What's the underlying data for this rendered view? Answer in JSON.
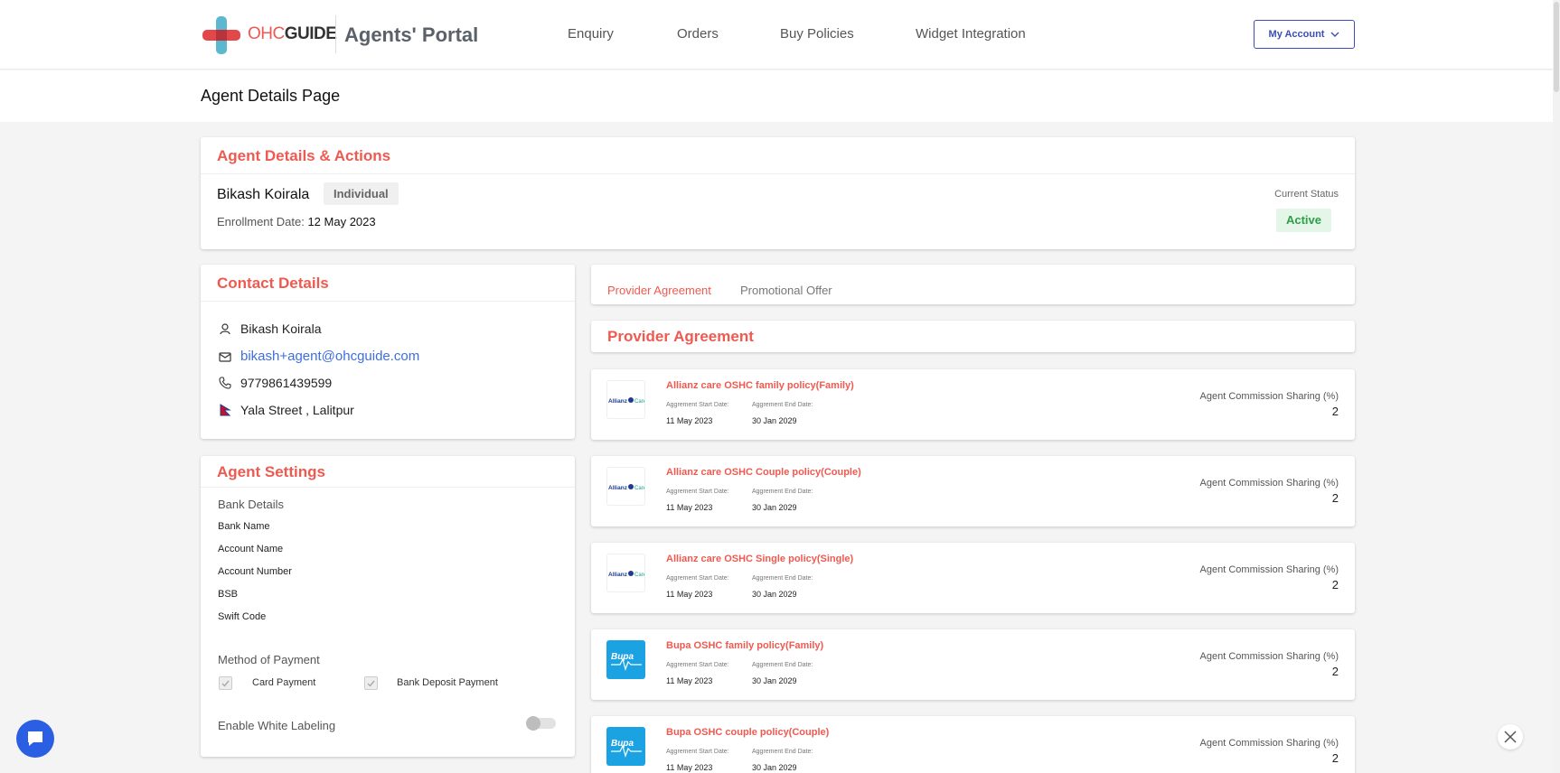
{
  "header": {
    "brand_part1": "OHC",
    "brand_part2": "GUIDE",
    "portal_title": "Agents' Portal",
    "nav": [
      "Enquiry",
      "Orders",
      "Buy Policies",
      "Widget Integration"
    ],
    "account_label": "My Account"
  },
  "page": {
    "title": "Agent Details Page"
  },
  "agent_details": {
    "title": "Agent Details & Actions",
    "name": "Bikash Koirala",
    "type": "Individual",
    "enrollment_label": "Enrollment Date:",
    "enrollment_date": "12 May 2023",
    "status_label": "Current Status",
    "status": "Active"
  },
  "contact": {
    "title": "Contact Details",
    "name": "Bikash Koirala",
    "email": "bikash+agent@ohcguide.com",
    "phone": "9779861439599",
    "address": "Yala Street , Lalitpur"
  },
  "settings": {
    "title": "Agent Settings",
    "bank_heading": "Bank Details",
    "bank_fields": [
      "Bank Name",
      "Account Name",
      "Account Number",
      "BSB",
      "Swift Code"
    ],
    "payment_heading": "Method of Payment",
    "card_payment": "Card Payment",
    "bank_deposit": "Bank Deposit Payment",
    "white_label": "Enable White Labeling"
  },
  "tabs": {
    "active": "Provider Agreement",
    "inactive": "Promotional Offer"
  },
  "provider_agreement": {
    "title": "Provider Agreement",
    "start_label": "Aggrement Start Date:",
    "end_label": "Aggrement End Date:",
    "commission_label": "Agent Commission Sharing (%)",
    "policies": [
      {
        "name": "Allianz care OSHC family policy(Family)",
        "provider": "allianz",
        "logo_text": "Allianz",
        "logo_text2": "Care",
        "start": "11 May 2023",
        "end": "30 Jan 2029",
        "commission": "2"
      },
      {
        "name": "Allianz care OSHC Couple policy(Couple)",
        "provider": "allianz",
        "logo_text": "Allianz",
        "logo_text2": "Care",
        "start": "11 May 2023",
        "end": "30 Jan 2029",
        "commission": "2"
      },
      {
        "name": "Allianz care OSHC Single policy(Single)",
        "provider": "allianz",
        "logo_text": "Allianz",
        "logo_text2": "Care",
        "start": "11 May 2023",
        "end": "30 Jan 2029",
        "commission": "2"
      },
      {
        "name": "Bupa OSHC family policy(Family)",
        "provider": "bupa",
        "logo_text": "Bupa",
        "start": "11 May 2023",
        "end": "30 Jan 2029",
        "commission": "2"
      },
      {
        "name": "Bupa OSHC couple policy(Couple)",
        "provider": "bupa",
        "logo_text": "Bupa",
        "start": "11 May 2023",
        "end": "30 Jan 2029",
        "commission": "2"
      }
    ]
  },
  "colors": {
    "accent": "#ef5a50",
    "link": "#3d6ee0",
    "primary": "#3d4db7",
    "active_bg": "#e3f6e7",
    "active_text": "#2e9e4a",
    "bupa": "#1aa2e3"
  }
}
